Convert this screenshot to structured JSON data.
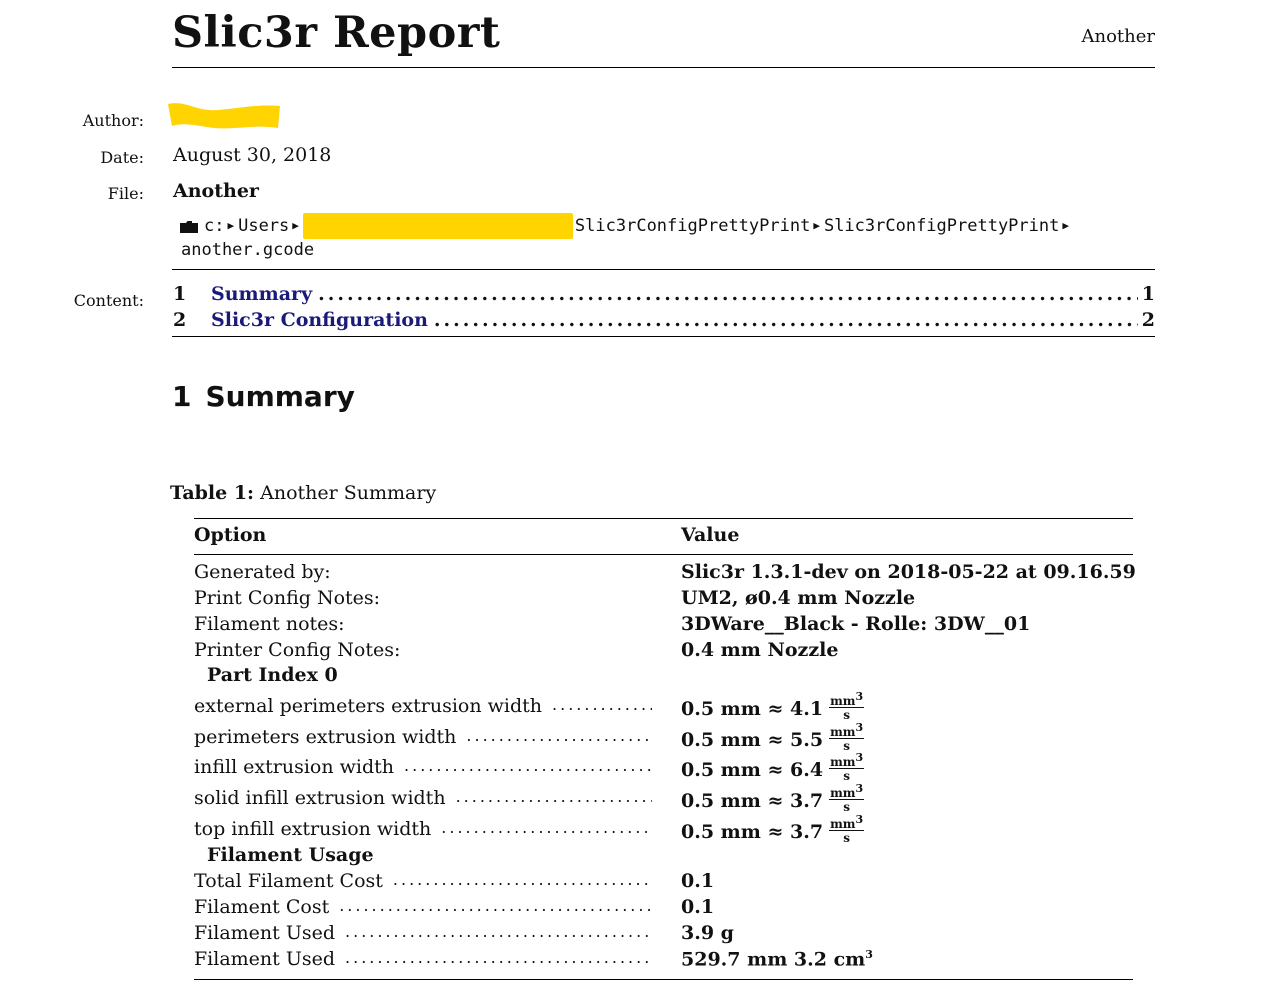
{
  "header": {
    "title": "Slic3r Report",
    "right_text": "Another"
  },
  "meta": {
    "author_label": "Author:",
    "date_label": "Date:",
    "date_value": "August 30, 2018",
    "file_label": "File:",
    "file_name": "Another",
    "path": {
      "folder_icon": "folder-icon",
      "segments_before_redaction": [
        "c:",
        "Users"
      ],
      "segments_after_redaction": [
        "Slic3rConfigPrettyPrint",
        "Slic3rConfigPrettyPrint"
      ],
      "last_line": "another.gcode"
    },
    "redaction_color": "#ffd400",
    "content_label": "Content:"
  },
  "toc": [
    {
      "number": "1",
      "title": "Summary",
      "page": "1"
    },
    {
      "number": "2",
      "title": "Slic3r Configuration",
      "page": "2"
    }
  ],
  "toc_link_color": "#1a1a7a",
  "section": {
    "number": "1",
    "title": "Summary"
  },
  "table": {
    "caption_label": "Table 1:",
    "caption_text": "Another Summary",
    "headers": {
      "option": "Option",
      "value": "Value"
    },
    "info_rows": [
      {
        "label": "Generated by:",
        "value": "Slic3r 1.3.1-dev on 2018-05-22 at 09.16.59"
      },
      {
        "label": "Print Config Notes:",
        "value": "UM2, ø0.4 mm Nozzle"
      },
      {
        "label": "Filament notes:",
        "value": "3DWare__Black - Rolle: 3DW__01"
      },
      {
        "label": "Printer Config Notes:",
        "value": "0.4 mm Nozzle"
      }
    ],
    "group_part_index": "Part Index 0",
    "width_rows": [
      {
        "label": "external perimeters extrusion width",
        "value": "0.5 mm ≈ 4.1"
      },
      {
        "label": "perimeters extrusion width",
        "value": "0.5 mm ≈ 5.5"
      },
      {
        "label": "infill extrusion width",
        "value": "0.5 mm ≈ 6.4"
      },
      {
        "label": "solid infill extrusion width",
        "value": "0.5 mm ≈ 3.7"
      },
      {
        "label": "top infill extrusion width",
        "value": "0.5 mm ≈ 3.7"
      }
    ],
    "rate_unit": {
      "numerator": "mm",
      "exponent": "3",
      "denominator": "s"
    },
    "group_filament": "Filament Usage",
    "filament_rows": [
      {
        "label": "Total Filament Cost",
        "value": "0.1"
      },
      {
        "label": "Filament Cost",
        "value": "0.1"
      },
      {
        "label": "Filament Used",
        "value": "3.9 g"
      },
      {
        "label": "Filament Used",
        "value": "529.7 mm 3.2 cm",
        "sup": "3"
      }
    ]
  }
}
